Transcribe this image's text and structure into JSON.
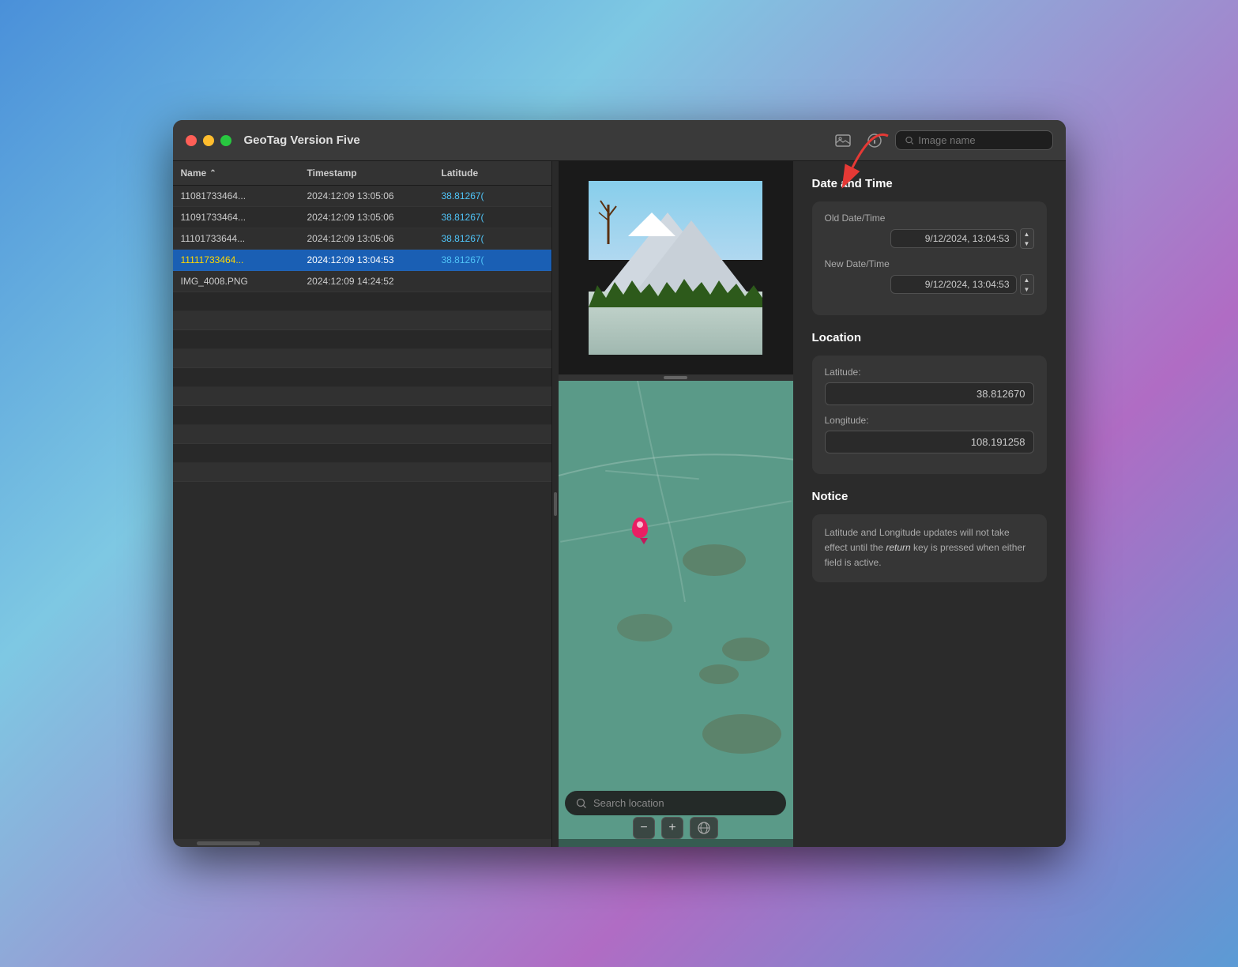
{
  "window": {
    "title": "GeoTag Version Five"
  },
  "titlebar": {
    "search_placeholder": "Image name",
    "icons": {
      "photo_icon": "🖼",
      "info_icon": "ℹ"
    }
  },
  "file_list": {
    "columns": {
      "name": "Name",
      "timestamp": "Timestamp",
      "latitude": "Latitude"
    },
    "rows": [
      {
        "name": "11081733464...",
        "timestamp": "2024:12:09 13:05:06",
        "latitude": "38.81267(",
        "selected": false
      },
      {
        "name": "11091733464...",
        "timestamp": "2024:12:09 13:05:06",
        "latitude": "38.81267(",
        "selected": false
      },
      {
        "name": "11101733644...",
        "timestamp": "2024:12:09 13:05:06",
        "latitude": "38.81267(",
        "selected": false
      },
      {
        "name": "11111733464...",
        "timestamp": "2024:12:09 13:04:53",
        "latitude": "38.81267(",
        "selected": true
      },
      {
        "name": "IMG_4008.PNG",
        "timestamp": "2024:12:09 14:24:52",
        "latitude": "",
        "selected": false
      }
    ]
  },
  "date_time": {
    "section_title": "Date and Time",
    "old_label": "Old Date/Time",
    "old_value": "9/12/2024, 13:04:53",
    "new_label": "New Date/Time",
    "new_value": "9/12/2024, 13:04:53"
  },
  "location": {
    "section_title": "Location",
    "latitude_label": "Latitude:",
    "latitude_value": "38.812670",
    "longitude_label": "Longitude:",
    "longitude_value": "108.191258"
  },
  "notice": {
    "section_title": "Notice",
    "text_part1": "Latitude and Longitude updates will not take effect until the ",
    "text_italic": "return",
    "text_part2": " key is pressed when either field is active."
  },
  "map": {
    "search_placeholder": "Search location",
    "zoom_minus": "−",
    "zoom_plus": "+"
  }
}
